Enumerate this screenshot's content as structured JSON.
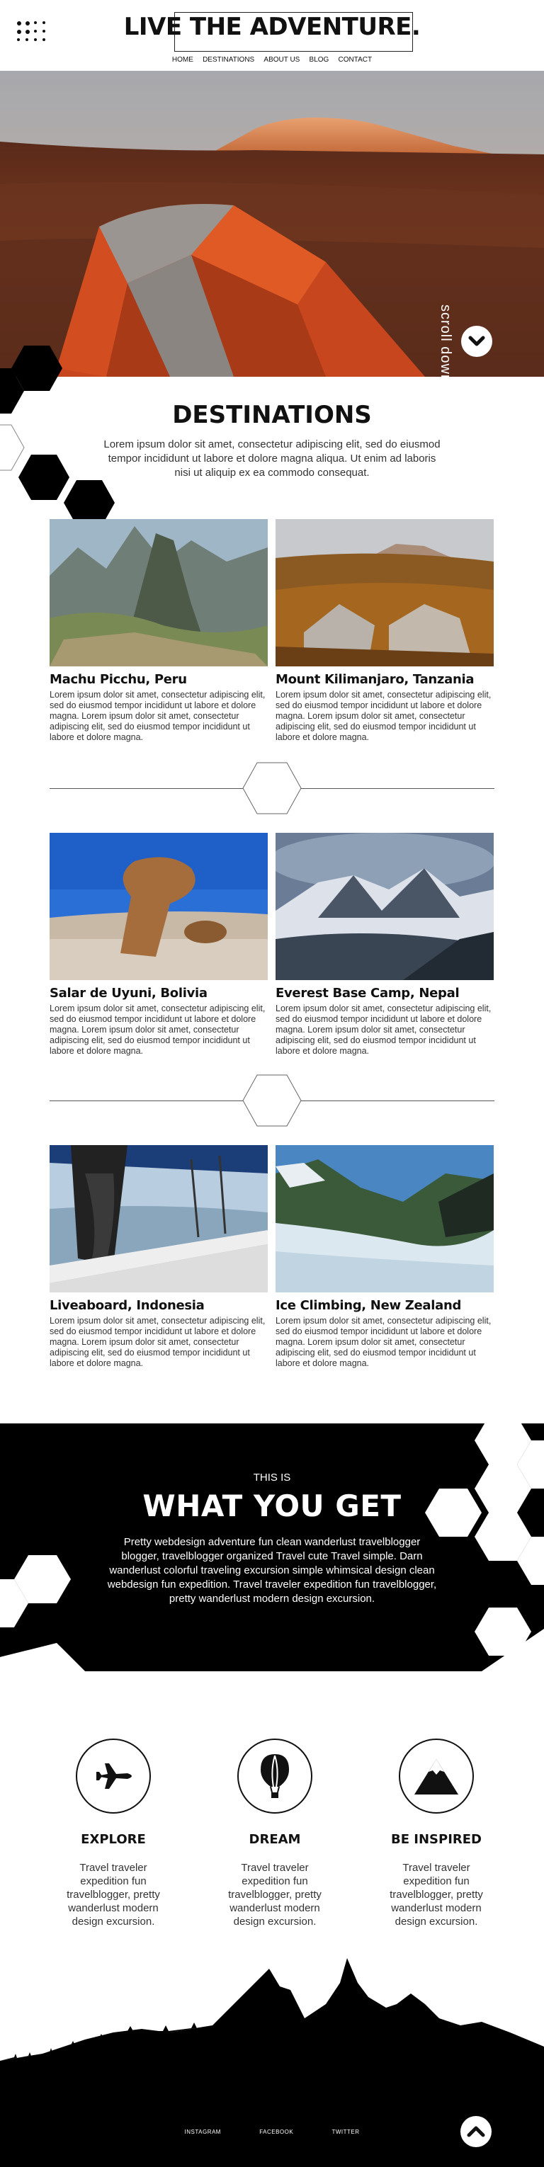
{
  "header": {
    "site_title": "LIVE THE ADVENTURE.",
    "nav": [
      "HOME",
      "DESTINATIONS",
      "ABOUT US",
      "BLOG",
      "CONTACT"
    ]
  },
  "hero": {
    "scroll_label": "scroll down"
  },
  "destinations": {
    "title": "DESTINATIONS",
    "intro": "Lorem ipsum dolor sit amet, consectetur adipiscing elit, sed do eiusmod tempor incididunt ut labore et dolore magna aliqua. Ut enim ad laboris nisi ut aliquip ex ea commodo consequat.",
    "cards": [
      {
        "title": "Machu Picchu, Peru",
        "text": "Lorem ipsum dolor sit amet, consectetur adipiscing elit, sed do eiusmod tempor incididunt ut labore et dolore magna. Lorem ipsum dolor sit amet, consectetur adipiscing elit, sed do eiusmod tempor incididunt ut labore et dolore magna."
      },
      {
        "title": "Mount Kilimanjaro, Tanzania",
        "text": "Lorem ipsum dolor sit amet, consectetur adipiscing elit, sed do eiusmod tempor incididunt ut labore et dolore magna. Lorem ipsum dolor sit amet, consectetur adipiscing elit, sed do eiusmod tempor incididunt ut labore et dolore magna."
      },
      {
        "title": "Salar de Uyuni, Bolivia",
        "text": "Lorem ipsum dolor sit amet, consectetur adipiscing elit, sed do eiusmod tempor incididunt ut labore et dolore magna. Lorem ipsum dolor sit amet, consectetur adipiscing elit, sed do eiusmod tempor incididunt ut labore et dolore magna."
      },
      {
        "title": "Everest Base Camp, Nepal",
        "text": "Lorem ipsum dolor sit amet, consectetur adipiscing elit, sed do eiusmod tempor incididunt ut labore et dolore magna. Lorem ipsum dolor sit amet, consectetur adipiscing elit, sed do eiusmod tempor incididunt ut labore et dolore magna."
      },
      {
        "title": "Liveaboard, Indonesia",
        "text": "Lorem ipsum dolor sit amet, consectetur adipiscing elit, sed do eiusmod tempor incididunt ut labore et dolore magna. Lorem ipsum dolor sit amet, consectetur adipiscing elit, sed do eiusmod tempor incididunt ut labore et dolore magna."
      },
      {
        "title": "Ice Climbing, New Zealand",
        "text": "Lorem ipsum dolor sit amet, consectetur adipiscing elit, sed do eiusmod tempor incididunt ut labore et dolore magna. Lorem ipsum dolor sit amet, consectetur adipiscing elit, sed do eiusmod tempor incididunt ut labore et dolore magna."
      }
    ]
  },
  "what_you_get": {
    "eyebrow": "THIS IS",
    "title": "WHAT YOU GET",
    "text": "Pretty webdesign adventure fun clean wanderlust travelblogger blogger, travelblogger organized Travel cute Travel simple. Darn wanderlust colorful traveling excursion simple whimsical design clean webdesign fun expedition. Travel traveler expedition fun travelblogger, pretty wanderlust modern design excursion."
  },
  "features": [
    {
      "icon": "airplane-icon",
      "title": "EXPLORE",
      "text": "Travel traveler expedition fun travelblogger, pretty wanderlust modern design excursion."
    },
    {
      "icon": "hot-air-balloon-icon",
      "title": "DREAM",
      "text": "Travel traveler expedition fun travelblogger, pretty wanderlust modern design excursion."
    },
    {
      "icon": "mountain-icon",
      "title": "BE INSPIRED",
      "text": "Travel traveler expedition fun travelblogger, pretty wanderlust modern design excursion."
    }
  ],
  "footer": {
    "links": [
      "INSTAGRAM",
      "FACEBOOK",
      "TWITTER"
    ]
  },
  "colors": {
    "primary": "#000000",
    "background": "#ffffff",
    "accent": "#d9522a"
  }
}
